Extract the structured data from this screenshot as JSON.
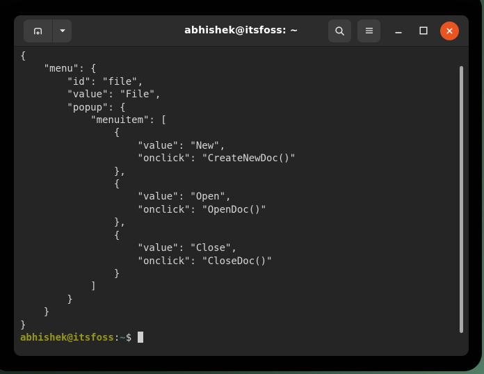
{
  "titlebar": {
    "title": "abhishek@itsfoss: ~",
    "icons": {
      "new_tab": "tab-with-plus",
      "tab_dropdown": "chevron-down",
      "search": "magnifier",
      "menu": "hamburger",
      "minimize": "dash",
      "maximize": "square-outline",
      "close": "x-in-orange-circle"
    }
  },
  "terminal": {
    "json_output": "{\n    \"menu\": {\n        \"id\": \"file\",\n        \"value\": \"File\",\n        \"popup\": {\n            \"menuitem\": [\n                {\n                    \"value\": \"New\",\n                    \"onclick\": \"CreateNewDoc()\"\n                },\n                {\n                    \"value\": \"Open\",\n                    \"onclick\": \"OpenDoc()\"\n                },\n                {\n                    \"value\": \"Close\",\n                    \"onclick\": \"CloseDoc()\"\n                }\n            ]\n        }\n    }\n}",
    "prompt": {
      "user_host": "abhishek@itsfoss",
      "separator": ":",
      "path": "~",
      "symbol": "$"
    }
  },
  "colors": {
    "close_button": "#E95420",
    "titlebar_bg": "#2C2C2C",
    "terminal_bg": "#252525",
    "terminal_fg": "#D6D6D6",
    "prompt_user": "#98971A",
    "prompt_path": "#458588",
    "page_background": "#24402F"
  }
}
